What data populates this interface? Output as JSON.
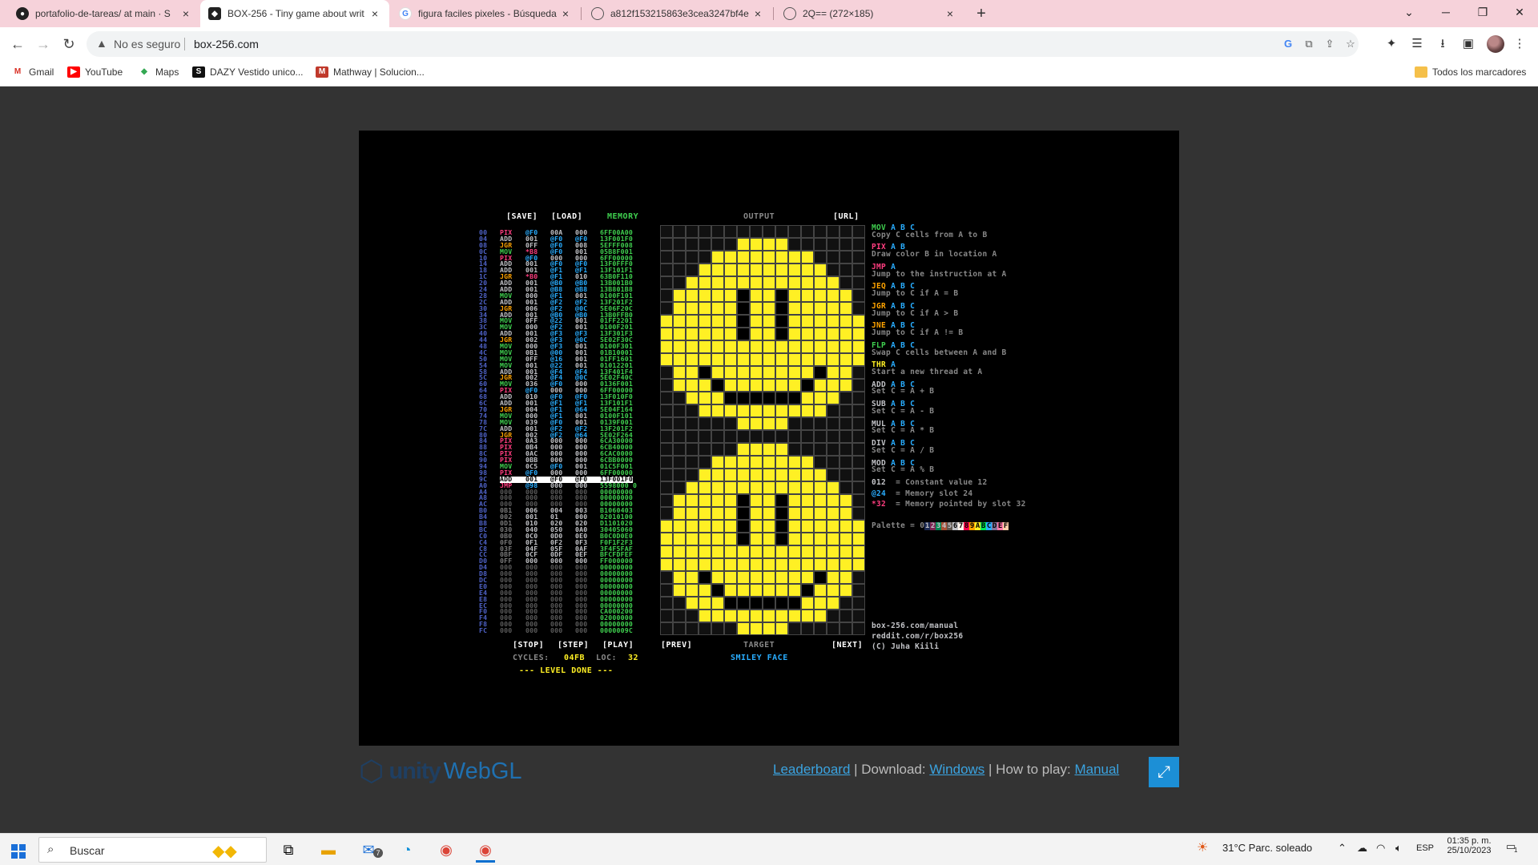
{
  "browser": {
    "tabs": [
      {
        "title": "portafolio-de-tareas/ at main · S",
        "icon": "github-icon"
      },
      {
        "title": "BOX-256 - Tiny game about writ",
        "icon": "unity-icon",
        "active": true
      },
      {
        "title": "figura faciles pixeles - Búsqueda",
        "icon": "google-icon"
      },
      {
        "title": "a812f153215863e3cea3247bf4e",
        "icon": "globe-icon"
      },
      {
        "title": "2Q== (272×185)",
        "icon": "globe-icon"
      }
    ],
    "not_secure": "No es seguro",
    "url": "box-256.com",
    "bookmarks": [
      "Gmail",
      "YouTube",
      "Maps",
      "DAZY Vestido unico...",
      "Mathway | Solucion..."
    ],
    "all_bookmarks": "Todos los marcadores"
  },
  "game": {
    "save": "[SAVE]",
    "load": "[LOAD]",
    "memory": "MEMORY",
    "output": "OUTPUT",
    "url_btn": "[URL]",
    "stop": "[STOP]",
    "step": "[STEP]",
    "play": "[PLAY]",
    "prev": "[PREV]",
    "target": "TARGET",
    "next": "[NEXT]",
    "cycles_label": "CYCLES:",
    "cycles_value": "04FB",
    "loc_label": "LOC:",
    "loc_value": "32",
    "level_name": "SMILEY FACE",
    "level_done": "--- LEVEL DONE ---",
    "code": [
      [
        "00",
        "PIX",
        "@F0",
        "00A",
        "000",
        "6FF00A00"
      ],
      [
        "04",
        "ADD",
        "001",
        "@F0",
        "@F0",
        "13F001F0"
      ],
      [
        "08",
        "JGR",
        "0FF",
        "@F0",
        "008",
        "5EFFF008"
      ],
      [
        "0C",
        "MOV",
        "*B8",
        "@F0",
        "001",
        "05B8F001"
      ],
      [
        "10",
        "PIX",
        "@F0",
        "000",
        "000",
        "6FF00000"
      ],
      [
        "14",
        "ADD",
        "001",
        "@F0",
        "@F0",
        "13F0FFF0"
      ],
      [
        "18",
        "ADD",
        "001",
        "@F1",
        "@F1",
        "13F101F1"
      ],
      [
        "1C",
        "JGR",
        "*B0",
        "@F1",
        "010",
        "63B0F110"
      ],
      [
        "20",
        "ADD",
        "001",
        "@B0",
        "@B0",
        "13B001B0"
      ],
      [
        "24",
        "ADD",
        "001",
        "@B8",
        "@B8",
        "13B801B8"
      ],
      [
        "28",
        "MOV",
        "000",
        "@F1",
        "001",
        "0100F101"
      ],
      [
        "2C",
        "ADD",
        "001",
        "@F2",
        "@F2",
        "13F201F2"
      ],
      [
        "30",
        "JGR",
        "006",
        "@F2",
        "@0C",
        "5E06F20C"
      ],
      [
        "34",
        "ADD",
        "001",
        "@B0",
        "@B0",
        "13B0FFB0"
      ],
      [
        "38",
        "MOV",
        "0FF",
        "@22",
        "001",
        "01FF2201"
      ],
      [
        "3C",
        "MOV",
        "000",
        "@F2",
        "001",
        "0100F201"
      ],
      [
        "40",
        "ADD",
        "001",
        "@F3",
        "@F3",
        "13F301F3"
      ],
      [
        "44",
        "JGR",
        "002",
        "@F3",
        "@0C",
        "5E02F30C"
      ],
      [
        "48",
        "MOV",
        "000",
        "@F3",
        "001",
        "0100F301"
      ],
      [
        "4C",
        "MOV",
        "0B1",
        "@00",
        "001",
        "01B10001"
      ],
      [
        "50",
        "MOV",
        "0FF",
        "@16",
        "001",
        "01FF1601"
      ],
      [
        "54",
        "MOV",
        "001",
        "@22",
        "001",
        "01012201"
      ],
      [
        "58",
        "ADD",
        "001",
        "@F4",
        "@F4",
        "13F401F4"
      ],
      [
        "5C",
        "JGR",
        "002",
        "@F4",
        "@0C",
        "5E02F40C"
      ],
      [
        "60",
        "MOV",
        "036",
        "@F0",
        "000",
        "0136F001"
      ],
      [
        "64",
        "PIX",
        "@F0",
        "000",
        "000",
        "6FF00000"
      ],
      [
        "68",
        "ADD",
        "010",
        "@F0",
        "@F0",
        "13F010F0"
      ],
      [
        "6C",
        "ADD",
        "001",
        "@F1",
        "@F1",
        "13F101F1"
      ],
      [
        "70",
        "JGR",
        "004",
        "@F1",
        "@64",
        "5E04F164"
      ],
      [
        "74",
        "MOV",
        "000",
        "@F1",
        "001",
        "0100F101"
      ],
      [
        "78",
        "MOV",
        "039",
        "@F0",
        "001",
        "0139F001"
      ],
      [
        "7C",
        "ADD",
        "001",
        "@F2",
        "@F2",
        "13F201F2"
      ],
      [
        "80",
        "JGR",
        "002",
        "@F2",
        "@64",
        "5E02F264"
      ],
      [
        "84",
        "PIX",
        "0A3",
        "000",
        "000",
        "6CA30000"
      ],
      [
        "88",
        "PIX",
        "0B4",
        "000",
        "000",
        "6CB40000"
      ],
      [
        "8C",
        "PIX",
        "0AC",
        "000",
        "000",
        "6CAC0000"
      ],
      [
        "90",
        "PIX",
        "0BB",
        "000",
        "000",
        "6CBB0000"
      ],
      [
        "94",
        "MOV",
        "0C5",
        "@F0",
        "001",
        "01C5F001"
      ],
      [
        "98",
        "PIX",
        "@F0",
        "000",
        "000",
        "6FF00000"
      ],
      [
        "9C",
        "ADD",
        "001",
        "@F0",
        "@F0",
        "13F001F0"
      ],
      [
        "A0",
        "JMP",
        "@98",
        "000",
        "000",
        "5598000 0"
      ],
      [
        "A4",
        "000",
        "000",
        "000",
        "000",
        "00000000"
      ],
      [
        "A8",
        "000",
        "000",
        "000",
        "000",
        "00000000"
      ],
      [
        "AC",
        "000",
        "000",
        "000",
        "000",
        "00000000"
      ],
      [
        "B0",
        "0B1",
        "006",
        "004",
        "003",
        "B1060403"
      ],
      [
        "B4",
        "002",
        "001",
        "01 ",
        "000",
        "02010100"
      ],
      [
        "B8",
        "0D1",
        "010",
        "020",
        "020",
        "D1101020"
      ],
      [
        "BC",
        "030",
        "040",
        "050",
        "0A0",
        "30405060"
      ],
      [
        "C0",
        "0B0",
        "0C0",
        "0D0",
        "0E0",
        "B0C0D0E0"
      ],
      [
        "C4",
        "0F0",
        "0F1",
        "0F2",
        "0F3",
        "F0F1F2F3"
      ],
      [
        "C8",
        "03F",
        "04F",
        "05F",
        "0AF",
        "3F4F5FAF"
      ],
      [
        "CC",
        "0BF",
        "0CF",
        "0DF",
        "0EF",
        "BFCFDFEF"
      ],
      [
        "D0",
        "0FF",
        "000",
        "000",
        "000",
        "FF000000"
      ],
      [
        "D4",
        "000",
        "000",
        "000",
        "000",
        "00000000"
      ],
      [
        "D8",
        "000",
        "000",
        "000",
        "000",
        "00000000"
      ],
      [
        "DC",
        "000",
        "000",
        "000",
        "000",
        "00000000"
      ],
      [
        "E0",
        "000",
        "000",
        "000",
        "000",
        "00000000"
      ],
      [
        "E4",
        "000",
        "000",
        "000",
        "000",
        "00000000"
      ],
      [
        "E8",
        "000",
        "000",
        "000",
        "000",
        "00000000"
      ],
      [
        "EC",
        "000",
        "000",
        "000",
        "000",
        "00000000"
      ],
      [
        "F0",
        "000",
        "000",
        "000",
        "000",
        "CA000200"
      ],
      [
        "F4",
        "000",
        "000",
        "000",
        "000",
        "02000000"
      ],
      [
        "F8",
        "000",
        "000",
        "000",
        "000",
        "00000000"
      ],
      [
        "FC",
        "000",
        "000",
        "000",
        "000",
        "0000009C"
      ]
    ],
    "highlight_row": 39,
    "reference": [
      {
        "op": "MOV",
        "args": "A B C",
        "desc": "Copy C cells from A to B",
        "color": "#3fcf4f"
      },
      {
        "op": "PIX",
        "args": "A B",
        "desc": "Draw color B in location A",
        "color": "#ff3d7f"
      },
      {
        "op": "JMP",
        "args": "A",
        "desc": "Jump to the instruction at A",
        "color": "#ff3d7f"
      },
      {
        "op": "JEQ",
        "args": "A B C",
        "desc": "Jump to C if A = B",
        "color": "#ffa300"
      },
      {
        "op": "JGR",
        "args": "A B C",
        "desc": "Jump to C if A > B",
        "color": "#ffa300"
      },
      {
        "op": "JNE",
        "args": "A B C",
        "desc": "Jump to C if A != B",
        "color": "#ffa300"
      },
      {
        "op": "FLP",
        "args": "A B C",
        "desc": "Swap C cells between A and B",
        "color": "#3fcf4f"
      },
      {
        "op": "THR",
        "args": "A",
        "desc": "Start a new thread at A",
        "color": "#fff024"
      },
      {
        "op": "ADD",
        "args": "A B C",
        "desc": "Set C = A + B",
        "color": "#c2c3c7"
      },
      {
        "op": "SUB",
        "args": "A B C",
        "desc": "Set C = A - B",
        "color": "#c2c3c7"
      },
      {
        "op": "MUL",
        "args": "A B C",
        "desc": "Set C = A * B",
        "color": "#c2c3c7"
      },
      {
        "op": "DIV",
        "args": "A B C",
        "desc": "Set C = A / B",
        "color": "#c2c3c7"
      },
      {
        "op": "MOD",
        "args": "A B C",
        "desc": "Set C = A % B",
        "color": "#c2c3c7"
      }
    ],
    "notes": [
      {
        "sym": "012",
        "text": "= Constant value 12"
      },
      {
        "sym": "@24",
        "text": "= Memory slot 24"
      },
      {
        "sym": "*32",
        "text": "= Memory pointed by slot 32"
      }
    ],
    "palette_label": "Palette = 0",
    "palette_chars": "123456789ABCDEF",
    "palette_colors": [
      "#1d2b53",
      "#7e2553",
      "#008751",
      "#ab5236",
      "#5f574f",
      "#c2c3c7",
      "#fff1e8",
      "#ff004d",
      "#ffa300",
      "#fff024",
      "#00e756",
      "#29adff",
      "#83769c",
      "#ff77a8",
      "#ffccaa"
    ],
    "links": [
      "box-256.com/manual",
      "reddit.com/r/box256",
      "(C) Juha Kiili"
    ]
  },
  "page": {
    "unity_word": "unity",
    "webgl_word": "WebGL",
    "leaderboard": "Leaderboard",
    "sep1": " | Download: ",
    "windows": "Windows",
    "sep2": " | How to play: ",
    "manual": "Manual"
  },
  "taskbar": {
    "search": "Buscar",
    "weather": "31°C  Parc. soleado",
    "lang": "ESP",
    "time": "01:35 p. m.",
    "date": "25/10/2023",
    "mail_badge": "7",
    "notif_badge": "1"
  },
  "colors": {
    "smiley_yellow": "#fff024",
    "eye_black": "#000000",
    "empty": "#111111",
    "tab_strip": "#f6d2da",
    "accent": "#1c8fd6"
  }
}
